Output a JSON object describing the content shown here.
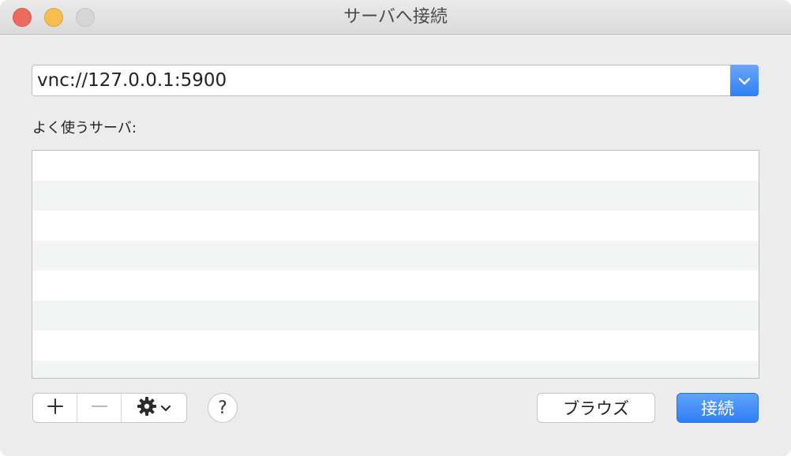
{
  "window": {
    "title": "サーバへ接続"
  },
  "address": {
    "value": "vnc://127.0.0.1:5900"
  },
  "favorites": {
    "label": "よく使うサーバ:",
    "rows": 8
  },
  "toolbar": {
    "add_symbol": "+",
    "remove_symbol": "—",
    "help_label": "?"
  },
  "buttons": {
    "browse_label": "ブラウズ",
    "connect_label": "接続"
  },
  "colors": {
    "accent": "#2f7ef5",
    "close": "#ee6a5e",
    "minimize": "#f5be4f",
    "zoom_disabled": "#d6d6d6"
  },
  "icons": {
    "dropdown": "chevron-down-icon",
    "action": "gear-icon"
  }
}
